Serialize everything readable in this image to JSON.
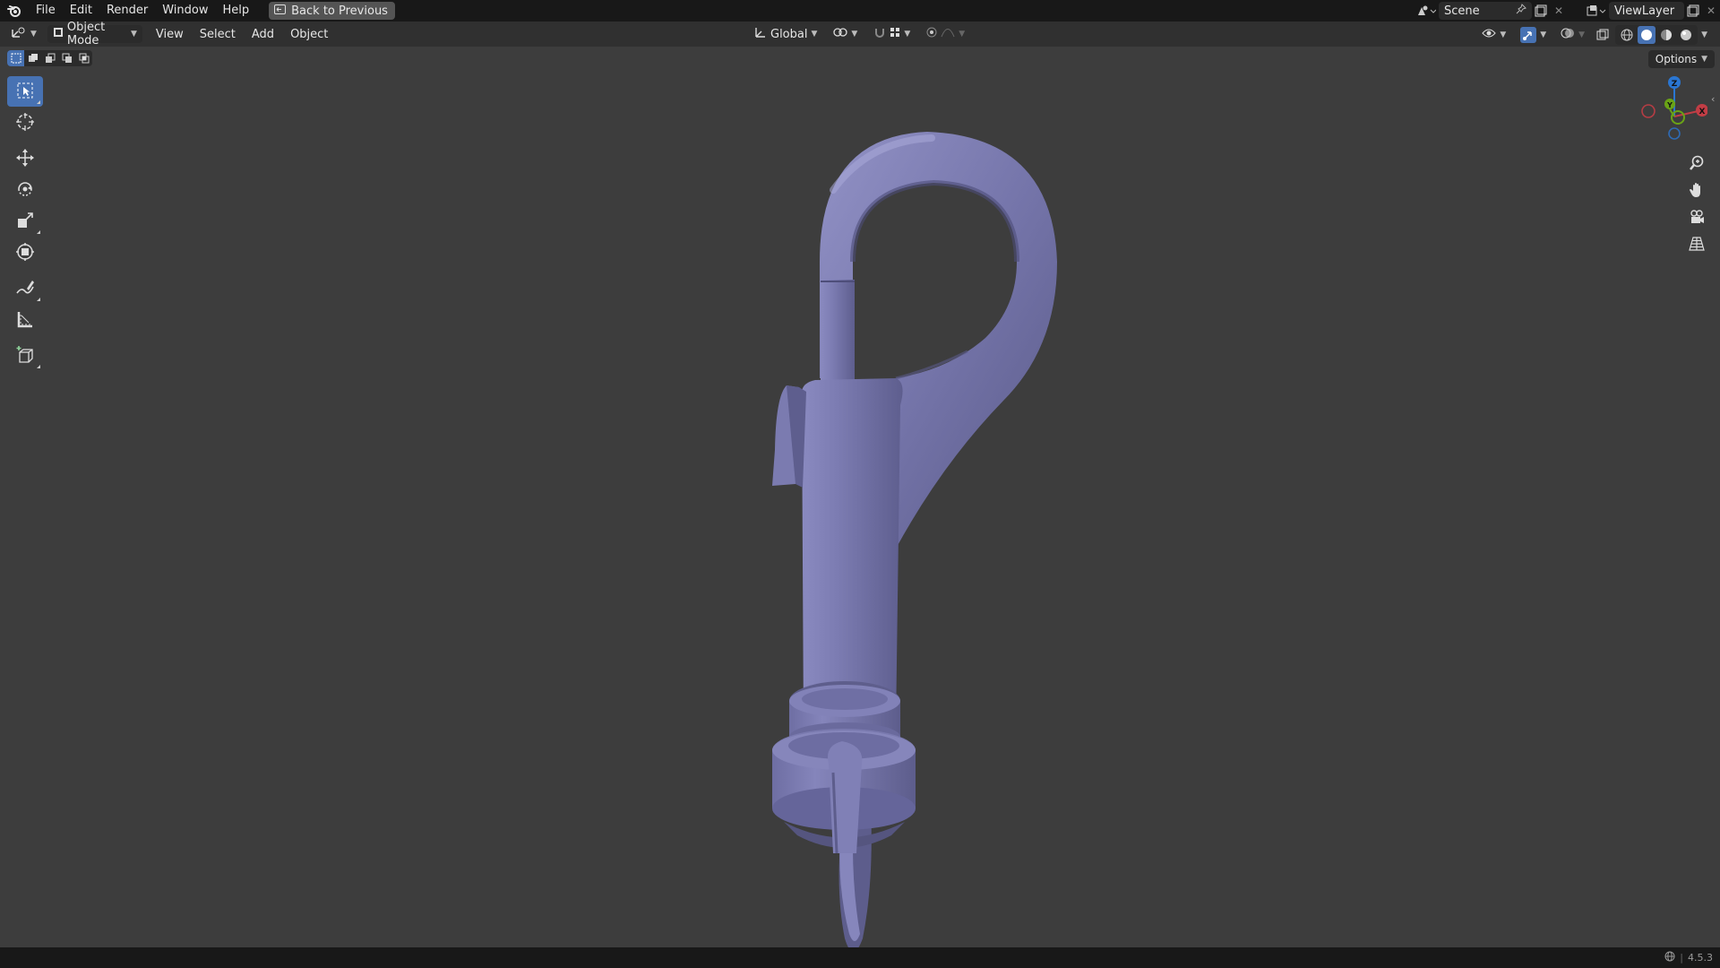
{
  "topbar": {
    "menus": [
      "File",
      "Edit",
      "Render",
      "Window",
      "Help"
    ],
    "back_button": "Back to Previous",
    "scene": "Scene",
    "view_layer": "ViewLayer"
  },
  "header": {
    "mode": "Object Mode",
    "menus": [
      "View",
      "Select",
      "Add",
      "Object"
    ],
    "transform_orientation": "Global"
  },
  "viewport": {
    "options_label": "Options",
    "gizmo": {
      "x": "X",
      "y": "Y",
      "z": "Z"
    },
    "model_color": "#7474a8"
  },
  "statusbar": {
    "version": "4.5.3"
  },
  "icons": {
    "tools": [
      "select-box-icon",
      "cursor-icon",
      "move-icon",
      "rotate-icon",
      "scale-icon",
      "transform-icon",
      "annotate-icon",
      "measure-icon",
      "add-cube-icon"
    ],
    "nav": [
      "zoom-icon",
      "pan-hand-icon",
      "camera-icon",
      "grid-view-icon"
    ]
  }
}
